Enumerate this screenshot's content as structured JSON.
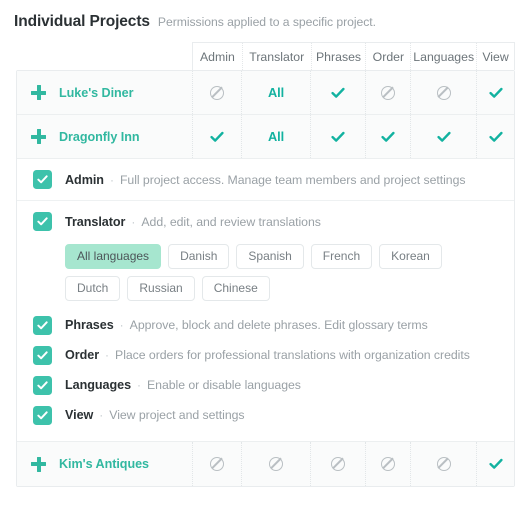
{
  "heading": {
    "title": "Individual Projects",
    "subtitle": "Permissions applied to a specific project."
  },
  "table": {
    "columns": [
      {
        "key": "admin",
        "label": "Admin"
      },
      {
        "key": "translator",
        "label": "Translator"
      },
      {
        "key": "phrases",
        "label": "Phrases"
      },
      {
        "key": "order",
        "label": "Order"
      },
      {
        "key": "languages",
        "label": "Languages"
      },
      {
        "key": "view",
        "label": "View"
      }
    ],
    "rows": [
      {
        "name": "Luke's Diner",
        "expand_icon": "plus-icon",
        "cells": [
          {
            "type": "ban"
          },
          {
            "type": "text",
            "value": "All"
          },
          {
            "type": "check"
          },
          {
            "type": "ban"
          },
          {
            "type": "ban"
          },
          {
            "type": "check"
          }
        ]
      },
      {
        "name": "Dragonfly Inn",
        "expand_icon": "plus-icon",
        "expanded": true,
        "cells": [
          {
            "type": "check"
          },
          {
            "type": "text",
            "value": "All"
          },
          {
            "type": "check"
          },
          {
            "type": "check"
          },
          {
            "type": "check"
          },
          {
            "type": "check"
          }
        ]
      },
      {
        "name": "Kim's Antiques",
        "expand_icon": "plus-icon",
        "cells": [
          {
            "type": "ban"
          },
          {
            "type": "ban"
          },
          {
            "type": "ban"
          },
          {
            "type": "ban"
          },
          {
            "type": "ban"
          },
          {
            "type": "check"
          }
        ]
      }
    ]
  },
  "detail": {
    "permissions": [
      {
        "key": "admin",
        "name": "Admin",
        "separator": "·",
        "description": "Full project access. Manage team members and project settings",
        "checked": true
      },
      {
        "key": "translator",
        "name": "Translator",
        "separator": "·",
        "description": "Add, edit, and review translations",
        "checked": true
      },
      {
        "key": "phrases",
        "name": "Phrases",
        "separator": "·",
        "description": "Approve, block and delete phrases. Edit glossary terms",
        "checked": true
      },
      {
        "key": "order",
        "name": "Order",
        "separator": "·",
        "description": "Place orders for professional translations with organization credits",
        "checked": true
      },
      {
        "key": "languages",
        "name": "Languages",
        "separator": "·",
        "description": "Enable or disable languages",
        "checked": true
      },
      {
        "key": "view",
        "name": "View",
        "separator": "·",
        "description": "View project and settings",
        "checked": true
      }
    ],
    "languages": [
      {
        "label": "All languages",
        "selected": true
      },
      {
        "label": "Danish",
        "selected": false
      },
      {
        "label": "Spanish",
        "selected": false
      },
      {
        "label": "French",
        "selected": false
      },
      {
        "label": "Korean",
        "selected": false
      },
      {
        "label": "Dutch",
        "selected": false
      },
      {
        "label": "Russian",
        "selected": false
      },
      {
        "label": "Chinese",
        "selected": false
      }
    ]
  },
  "colors": {
    "accent_teal": "#12b2a0",
    "link_teal": "#31b8a0",
    "checkbox_green": "#3dc2ab",
    "chip_selected": "#a6e6cf",
    "muted_text": "#9aa1a6",
    "ban_gray": "#b9bfc3",
    "border": "#e9ecee"
  }
}
